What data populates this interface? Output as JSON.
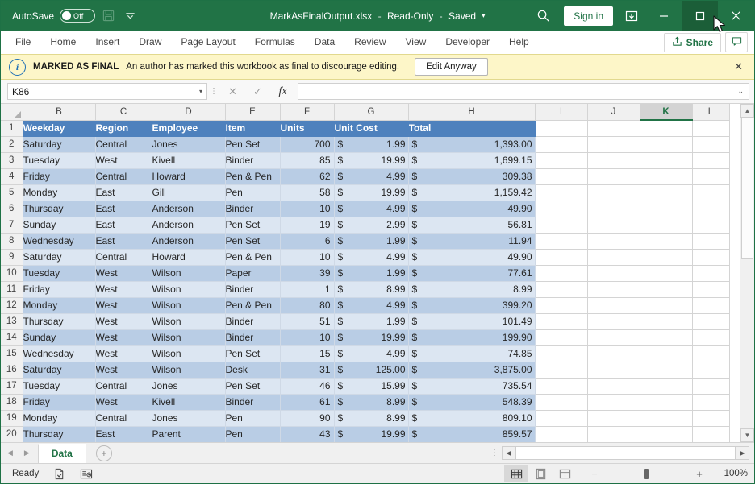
{
  "titlebar": {
    "autosave_label": "AutoSave",
    "autosave_state": "Off",
    "save_icon": "save-icon",
    "customize_qat_icon": "chevron-down-icon",
    "document_name": "MarkAsFinalOutput.xlsx",
    "sep1": "-",
    "readonly": "Read-Only",
    "sep2": "-",
    "saved": "Saved",
    "title_caret": "▾",
    "search_icon": "search-icon",
    "signin_label": "Sign in",
    "ribbon_display_icon": "ribbon-display-options-icon",
    "minimize_icon": "minimize-icon",
    "maximize_icon": "maximize-icon",
    "close_icon": "close-icon",
    "bar_color": "#217346"
  },
  "ribbon": {
    "tabs": [
      {
        "label": "File"
      },
      {
        "label": "Home"
      },
      {
        "label": "Insert"
      },
      {
        "label": "Draw"
      },
      {
        "label": "Page Layout"
      },
      {
        "label": "Formulas"
      },
      {
        "label": "Data"
      },
      {
        "label": "Review"
      },
      {
        "label": "View"
      },
      {
        "label": "Developer"
      },
      {
        "label": "Help"
      }
    ],
    "share_label": "Share",
    "share_icon": "share-icon",
    "comment_icon": "comment-icon",
    "accent_color": "#217346"
  },
  "messagebar": {
    "icon": "info-icon",
    "icon_glyph": "i",
    "strong": "MARKED AS FINAL",
    "text": "An author has marked this workbook as final to discourage editing.",
    "button_label": "Edit Anyway",
    "close_glyph": "✕",
    "background": "#fdf6c8"
  },
  "formulabar": {
    "namebox_value": "K86",
    "namebox_caret": "▾",
    "cancel_glyph": "✕",
    "enter_glyph": "✓",
    "fx_glyph": "fx",
    "formula_value": "",
    "expand_caret": "⌄"
  },
  "grid": {
    "corner_icon": "select-all-icon",
    "columns": [
      "B",
      "C",
      "D",
      "E",
      "F",
      "G",
      "H",
      "I",
      "J",
      "K",
      "L"
    ],
    "selected_column": "K",
    "row_numbers": [
      1,
      2,
      3,
      4,
      5,
      6,
      7,
      8,
      9,
      10,
      11,
      12,
      13,
      14,
      15,
      16,
      17,
      18,
      19,
      20
    ],
    "header_row": [
      "Weekday",
      "Region",
      "Employee",
      "Item",
      "Units",
      "Unit Cost",
      "Total"
    ],
    "header_bg": "#4e81bd",
    "band_a": "#b9cde5",
    "band_b": "#dce6f2",
    "currency_symbol": "$",
    "rows": [
      {
        "weekday": "Saturday",
        "region": "Central",
        "employee": "Jones",
        "item": "Pen Set",
        "units": "700",
        "unit_cost": "1.99",
        "total": "1,393.00"
      },
      {
        "weekday": "Tuesday",
        "region": "West",
        "employee": "Kivell",
        "item": "Binder",
        "units": "85",
        "unit_cost": "19.99",
        "total": "1,699.15"
      },
      {
        "weekday": "Friday",
        "region": "Central",
        "employee": "Howard",
        "item": "Pen & Pen",
        "units": "62",
        "unit_cost": "4.99",
        "total": "309.38"
      },
      {
        "weekday": "Monday",
        "region": "East",
        "employee": "Gill",
        "item": "Pen",
        "units": "58",
        "unit_cost": "19.99",
        "total": "1,159.42"
      },
      {
        "weekday": "Thursday",
        "region": "East",
        "employee": "Anderson",
        "item": "Binder",
        "units": "10",
        "unit_cost": "4.99",
        "total": "49.90"
      },
      {
        "weekday": "Sunday",
        "region": "East",
        "employee": "Anderson",
        "item": "Pen Set",
        "units": "19",
        "unit_cost": "2.99",
        "total": "56.81"
      },
      {
        "weekday": "Wednesday",
        "region": "East",
        "employee": "Anderson",
        "item": "Pen Set",
        "units": "6",
        "unit_cost": "1.99",
        "total": "11.94"
      },
      {
        "weekday": "Saturday",
        "region": "Central",
        "employee": "Howard",
        "item": "Pen & Pen",
        "units": "10",
        "unit_cost": "4.99",
        "total": "49.90"
      },
      {
        "weekday": "Tuesday",
        "region": "West",
        "employee": "Wilson",
        "item": "Paper",
        "units": "39",
        "unit_cost": "1.99",
        "total": "77.61"
      },
      {
        "weekday": "Friday",
        "region": "West",
        "employee": "Wilson",
        "item": "Binder",
        "units": "1",
        "unit_cost": "8.99",
        "total": "8.99"
      },
      {
        "weekday": "Monday",
        "region": "West",
        "employee": "Wilson",
        "item": "Pen & Pen",
        "units": "80",
        "unit_cost": "4.99",
        "total": "399.20"
      },
      {
        "weekday": "Thursday",
        "region": "West",
        "employee": "Wilson",
        "item": "Binder",
        "units": "51",
        "unit_cost": "1.99",
        "total": "101.49"
      },
      {
        "weekday": "Sunday",
        "region": "West",
        "employee": "Wilson",
        "item": "Binder",
        "units": "10",
        "unit_cost": "19.99",
        "total": "199.90"
      },
      {
        "weekday": "Wednesday",
        "region": "West",
        "employee": "Wilson",
        "item": "Pen Set",
        "units": "15",
        "unit_cost": "4.99",
        "total": "74.85"
      },
      {
        "weekday": "Saturday",
        "region": "West",
        "employee": "Wilson",
        "item": "Desk",
        "units": "31",
        "unit_cost": "125.00",
        "total": "3,875.00"
      },
      {
        "weekday": "Tuesday",
        "region": "Central",
        "employee": "Jones",
        "item": "Pen Set",
        "units": "46",
        "unit_cost": "15.99",
        "total": "735.54"
      },
      {
        "weekday": "Friday",
        "region": "West",
        "employee": "Kivell",
        "item": "Binder",
        "units": "61",
        "unit_cost": "8.99",
        "total": "548.39"
      },
      {
        "weekday": "Monday",
        "region": "Central",
        "employee": "Jones",
        "item": "Pen",
        "units": "90",
        "unit_cost": "8.99",
        "total": "809.10"
      },
      {
        "weekday": "Thursday",
        "region": "East",
        "employee": "Parent",
        "item": "Pen",
        "units": "43",
        "unit_cost": "19.99",
        "total": "859.57"
      }
    ]
  },
  "sheettabs": {
    "prev_glyph": "◀",
    "next_glyph": "▶",
    "tabs": [
      {
        "label": "Data",
        "active": true
      }
    ],
    "add_glyph": "+",
    "hscroll_left": "◀",
    "hscroll_right": "▶"
  },
  "statusbar": {
    "mode": "Ready",
    "accessibility_icon": "accessibility-checker-icon",
    "macro_icon": "record-macro-icon",
    "view_normal_icon": "normal-view-icon",
    "view_pagelayout_icon": "page-layout-view-icon",
    "view_pagebreak_icon": "page-break-preview-icon",
    "zoom_out_glyph": "−",
    "zoom_in_glyph": "+",
    "zoom_value": "100%"
  }
}
